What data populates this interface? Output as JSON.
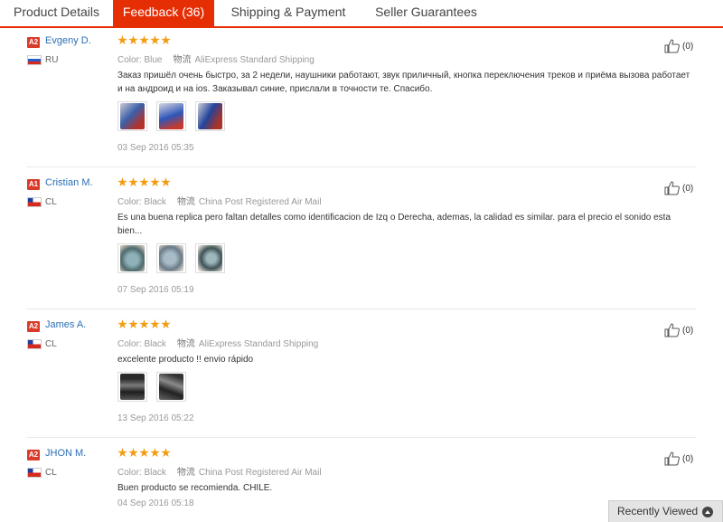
{
  "tabs": [
    {
      "label": "Product Details"
    },
    {
      "label": "Feedback",
      "count": "(36)"
    },
    {
      "label": "Shipping & Payment"
    },
    {
      "label": "Seller Guarantees"
    }
  ],
  "reviews": [
    {
      "badge": "A2",
      "user": "Evgeny D.",
      "country": "RU",
      "rating": 5,
      "color_label": "Color:",
      "color": "Blue",
      "logistics_prefix": "物流",
      "shipping": "AliExpress Standard Shipping",
      "comment": "Заказ пришёл очень быстро, за 2 недели, наушники работают, звук приличный, кнопка переключения треков и приёма вызова работает и на андроид и на ios. Заказывал синие, прислали в точности те. Спасибо.",
      "images": [
        "photo-1",
        "photo-2",
        "photo-3"
      ],
      "date": "03 Sep 2016 05:35",
      "helpful": "(0)"
    },
    {
      "badge": "A1",
      "user": "Cristian M.",
      "country": "CL",
      "rating": 5,
      "color_label": "Color:",
      "color": "Black",
      "logistics_prefix": "物流",
      "shipping": "China Post Registered Air Mail",
      "comment": "Es una buena replica pero faltan detalles como identificacion de Izq o Derecha, ademas, la calidad es similar. para el precio el sonido esta bien...",
      "images": [
        "photo-1",
        "photo-2",
        "photo-3"
      ],
      "date": "07 Sep 2016 05:19",
      "helpful": "(0)"
    },
    {
      "badge": "A2",
      "user": "James A.",
      "country": "CL",
      "rating": 5,
      "color_label": "Color:",
      "color": "Black",
      "logistics_prefix": "物流",
      "shipping": "AliExpress Standard Shipping",
      "comment": "excelente producto !! envio rápido",
      "images": [
        "photo-1",
        "photo-2"
      ],
      "date": "13 Sep 2016 05:22",
      "helpful": "(0)"
    },
    {
      "badge": "A2",
      "user": "JHON M.",
      "country": "CL",
      "rating": 5,
      "color_label": "Color:",
      "color": "Black",
      "logistics_prefix": "物流",
      "shipping": "China Post Registered Air Mail",
      "comment": "Buen producto se recomienda. CHILE.",
      "images": [],
      "date": "04 Sep 2016 05:18",
      "helpful": "(0)"
    }
  ],
  "recently_viewed": {
    "label": "Recently Viewed",
    "icon": "chevron-up-circle-icon"
  },
  "colors": {
    "accent": "#e62e04",
    "star": "#f39c12",
    "link": "#2a6fb7",
    "badge": "#d93b2a"
  }
}
